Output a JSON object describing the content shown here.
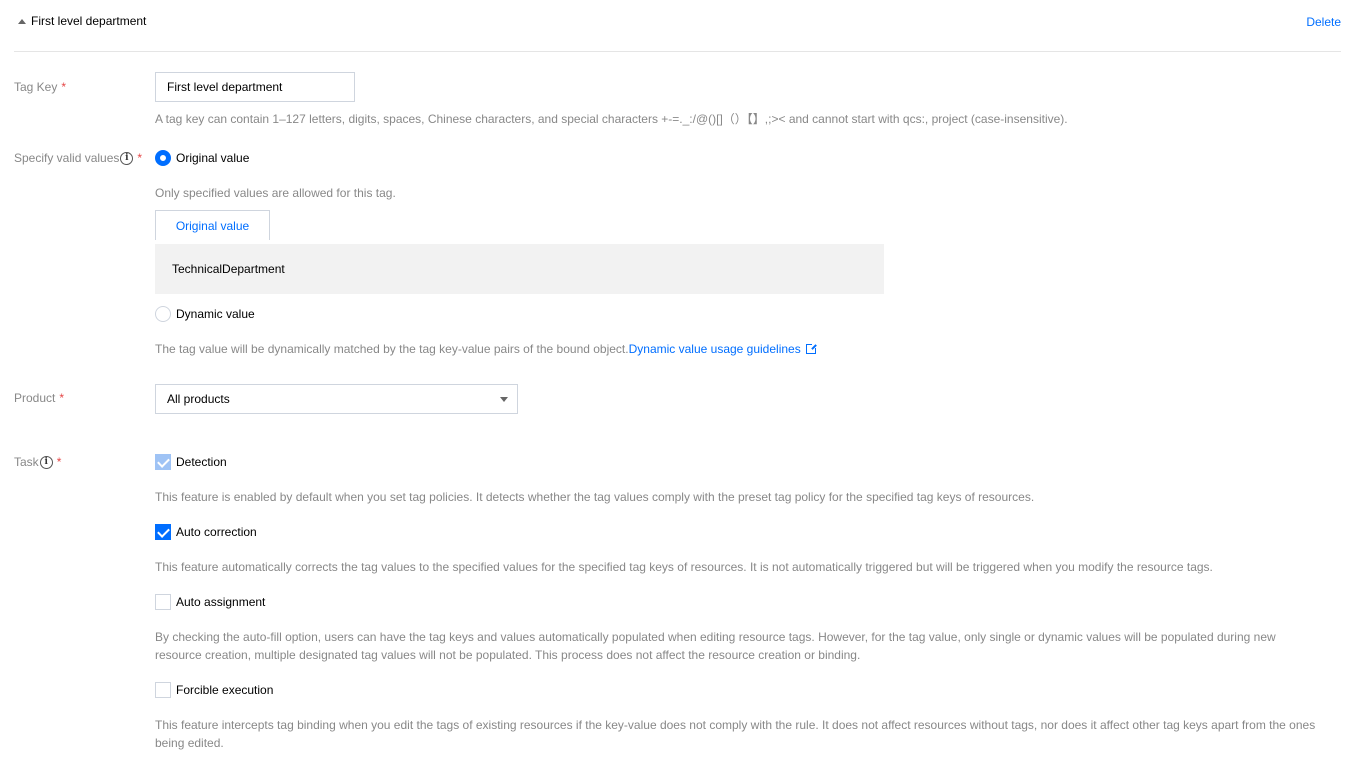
{
  "header": {
    "title": "First level department",
    "delete_label": "Delete"
  },
  "tag_key": {
    "label": "Tag Key",
    "required_mark": "*",
    "value": "First level department",
    "help": "A tag key can contain 1–127 letters, digits, spaces, Chinese characters, and special characters +-=._:/@()[]（）【】,;>< and cannot start with qcs:, project (case-insensitive)."
  },
  "valid_values": {
    "label": "Specify valid values",
    "required_mark": "*",
    "info_glyph": "i",
    "original_option": "Original value",
    "original_selected": true,
    "original_help": "Only specified values are allowed for this tag.",
    "values_tab_label": "Original value",
    "values": [
      "TechnicalDepartment"
    ],
    "dynamic_option": "Dynamic value",
    "dynamic_help": "The tag value will be dynamically matched by the tag key-value pairs of the bound object.",
    "dynamic_link": "Dynamic value usage guidelines"
  },
  "product": {
    "label": "Product",
    "required_mark": "*",
    "selected": "All products"
  },
  "task": {
    "label": "Task",
    "required_mark": "*",
    "info_glyph": "i",
    "options": [
      {
        "label": "Detection",
        "checked": true,
        "disabled": true,
        "help": "This feature is enabled by default when you set tag policies. It detects whether the tag values comply with the preset tag policy for the specified tag keys of resources."
      },
      {
        "label": "Auto correction",
        "checked": true,
        "disabled": false,
        "help": "This feature automatically corrects the tag values to the specified values for the specified tag keys of resources. It is not automatically triggered but will be triggered when you modify the resource tags."
      },
      {
        "label": "Auto assignment",
        "checked": false,
        "disabled": false,
        "help": "By checking the auto-fill option, users can have the tag keys and values automatically populated when editing resource tags. However, for the tag value, only single or dynamic values will be populated during new resource creation, multiple designated tag values will not be populated. This process does not affect the resource creation or binding."
      },
      {
        "label": "Forcible execution",
        "checked": false,
        "disabled": false,
        "help": "This feature intercepts tag binding when you edit the tags of existing resources if the key-value does not comply with the rule. It does not affect resources without tags, nor does it affect other tag keys apart from the ones being edited."
      }
    ]
  },
  "colors": {
    "accent": "#006eff",
    "required": "#e54545",
    "muted_text": "#888888",
    "value_box_bg": "#f2f2f2"
  },
  "icons": [
    "collapse-triangle-icon",
    "info-icon",
    "external-link-icon",
    "chevron-down-icon",
    "checkmark-icon"
  ]
}
